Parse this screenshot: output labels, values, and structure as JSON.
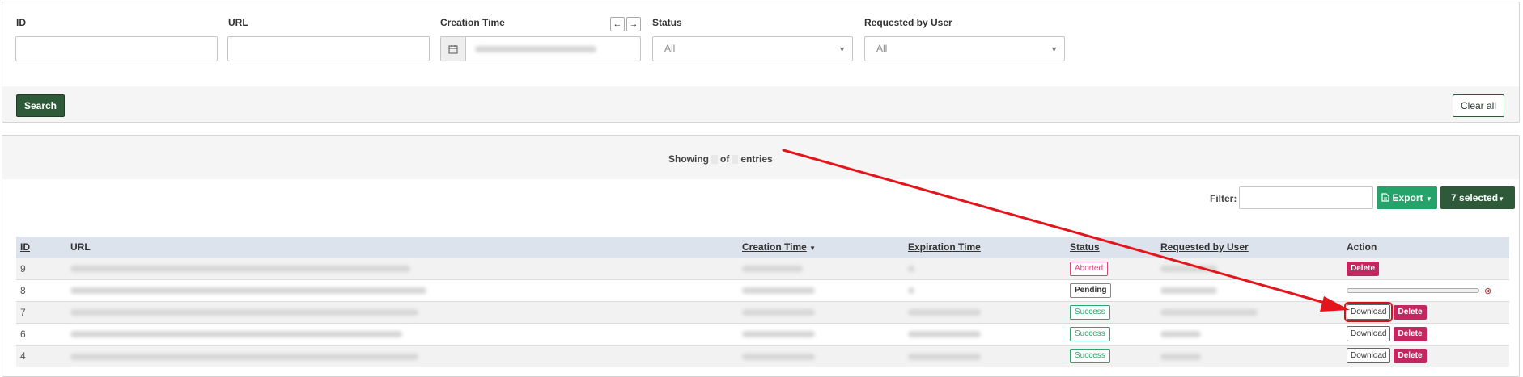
{
  "search": {
    "fields": {
      "id_label": "ID",
      "url_label": "URL",
      "creation_time_label": "Creation Time",
      "status_label": "Status",
      "requested_by_label": "Requested by User"
    },
    "status_value": "All",
    "requested_by_value": "All",
    "search_button": "Search",
    "clear_button": "Clear all",
    "prev_icon": "←",
    "next_icon": "→"
  },
  "results": {
    "showing_prefix": "Showing",
    "showing_of": "of",
    "showing_suffix": "entries",
    "filter_label": "Filter:",
    "export_button": "Export",
    "selected_button": "7 selected"
  },
  "table": {
    "headers": {
      "id": "ID",
      "url": "URL",
      "creation_time": "Creation Time",
      "expiration_time": "Expiration Time",
      "status": "Status",
      "requested_by": "Requested by User",
      "action": "Action"
    },
    "rows": [
      {
        "id": "9",
        "status": "Aborted",
        "delete_label": "Delete"
      },
      {
        "id": "8",
        "status": "Pending",
        "progress": 0.0,
        "cancel_icon": "⊗"
      },
      {
        "id": "7",
        "status": "Success",
        "download_label": "Download",
        "delete_label": "Delete"
      },
      {
        "id": "6",
        "status": "Success",
        "download_label": "Download",
        "delete_label": "Delete"
      },
      {
        "id": "4",
        "status": "Success",
        "download_label": "Download",
        "delete_label": "Delete"
      }
    ]
  },
  "colors": {
    "primary_dark_green": "#2e5a3a",
    "export_green": "#25a36b",
    "delete_crimson": "#c2275f",
    "annotation_red": "#d4121b"
  },
  "icons": {
    "calendar": "calendar-icon",
    "export": "file-export-icon",
    "sort": "sort-desc-icon",
    "cancel": "cancel-circle-icon"
  }
}
